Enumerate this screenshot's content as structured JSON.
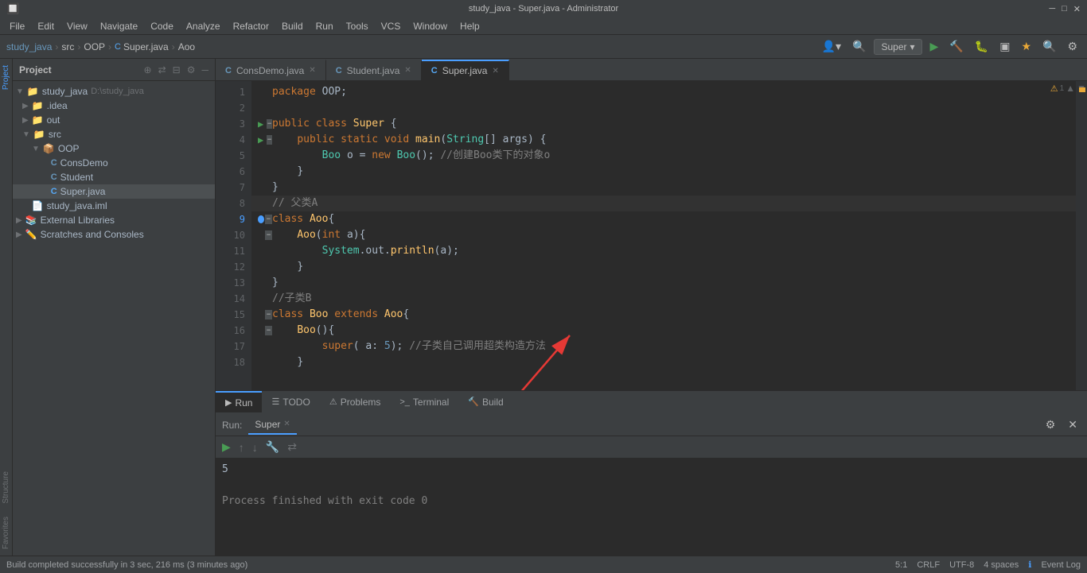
{
  "titleBar": {
    "title": "study_java - Super.java - Administrator",
    "minimize": "─",
    "maximize": "□",
    "close": "✕"
  },
  "menuBar": {
    "items": [
      "File",
      "Edit",
      "View",
      "Navigate",
      "Code",
      "Analyze",
      "Refactor",
      "Build",
      "Run",
      "Tools",
      "VCS",
      "Window",
      "Help"
    ]
  },
  "navBar": {
    "breadcrumb": [
      "study_java",
      "src",
      "OOP",
      "Super.java",
      "Aoo"
    ],
    "runConfig": "Super",
    "seps": [
      ">",
      ">",
      ">",
      ">"
    ]
  },
  "projectPanel": {
    "title": "Project",
    "tree": [
      {
        "label": "study_java",
        "path": "D:\\study_java",
        "indent": 0,
        "icon": "project",
        "arrow": "▼",
        "expanded": true
      },
      {
        "label": ".idea",
        "indent": 1,
        "icon": "folder",
        "arrow": "▶",
        "expanded": false
      },
      {
        "label": "out",
        "indent": 1,
        "icon": "folder-yellow",
        "arrow": "▶",
        "expanded": false
      },
      {
        "label": "src",
        "indent": 1,
        "icon": "folder",
        "arrow": "▼",
        "expanded": true
      },
      {
        "label": "OOP",
        "indent": 2,
        "icon": "folder-blue",
        "arrow": "▼",
        "expanded": true
      },
      {
        "label": "ConsDemo",
        "indent": 3,
        "icon": "java-class",
        "arrow": ""
      },
      {
        "label": "Student",
        "indent": 3,
        "icon": "java-class",
        "arrow": ""
      },
      {
        "label": "Super.java",
        "indent": 3,
        "icon": "java-class-active",
        "arrow": ""
      },
      {
        "label": "study_java.iml",
        "indent": 1,
        "icon": "iml",
        "arrow": ""
      },
      {
        "label": "External Libraries",
        "indent": 0,
        "icon": "library",
        "arrow": "▶",
        "expanded": false
      },
      {
        "label": "Scratches and Consoles",
        "indent": 0,
        "icon": "scratches",
        "arrow": "▶",
        "expanded": false
      }
    ]
  },
  "tabs": [
    {
      "label": "ConsDemo.java",
      "icon": "C",
      "iconColor": "#6897bb",
      "active": false,
      "modified": false
    },
    {
      "label": "Student.java",
      "icon": "C",
      "iconColor": "#6897bb",
      "active": false,
      "modified": false
    },
    {
      "label": "Super.java",
      "icon": "C",
      "iconColor": "#56a8f5",
      "active": true,
      "modified": false
    }
  ],
  "code": {
    "lines": [
      {
        "num": 1,
        "content": "package OOP;",
        "hasArrow": false,
        "hasFold": false,
        "hasRun": false,
        "highlighted": false
      },
      {
        "num": 2,
        "content": "",
        "hasArrow": false,
        "hasFold": false,
        "hasRun": false,
        "highlighted": false
      },
      {
        "num": 3,
        "content": "public class Super {",
        "hasArrow": false,
        "hasFold": true,
        "hasRun": true,
        "highlighted": false
      },
      {
        "num": 4,
        "content": "    public static void main(String[] args) {",
        "hasArrow": false,
        "hasFold": true,
        "hasRun": true,
        "highlighted": false
      },
      {
        "num": 5,
        "content": "        Boo o = new Boo(); //创建Boo类下的对象o",
        "hasArrow": false,
        "hasFold": false,
        "hasRun": false,
        "highlighted": false
      },
      {
        "num": 6,
        "content": "    }",
        "hasArrow": false,
        "hasFold": false,
        "hasRun": false,
        "highlighted": false
      },
      {
        "num": 7,
        "content": "}",
        "hasArrow": false,
        "hasFold": false,
        "hasRun": false,
        "highlighted": false
      },
      {
        "num": 8,
        "content": "// 父类A",
        "hasArrow": false,
        "hasFold": false,
        "hasRun": false,
        "highlighted": true
      },
      {
        "num": 9,
        "content": "class Aoo{",
        "hasArrow": false,
        "hasFold": true,
        "hasRun": true,
        "highlighted": false
      },
      {
        "num": 10,
        "content": "    Aoo(int a){",
        "hasArrow": false,
        "hasFold": true,
        "hasRun": false,
        "highlighted": false
      },
      {
        "num": 11,
        "content": "        System.out.println(a);",
        "hasArrow": false,
        "hasFold": false,
        "hasRun": false,
        "highlighted": false
      },
      {
        "num": 12,
        "content": "    }",
        "hasArrow": false,
        "hasFold": false,
        "hasRun": false,
        "highlighted": false
      },
      {
        "num": 13,
        "content": "}",
        "hasArrow": false,
        "hasFold": false,
        "hasRun": false,
        "highlighted": false
      },
      {
        "num": 14,
        "content": "//子类B",
        "hasArrow": false,
        "hasFold": false,
        "hasRun": false,
        "highlighted": false
      },
      {
        "num": 15,
        "content": "class Boo extends Aoo{",
        "hasArrow": false,
        "hasFold": true,
        "hasRun": false,
        "highlighted": false
      },
      {
        "num": 16,
        "content": "    Boo(){",
        "hasArrow": false,
        "hasFold": true,
        "hasRun": false,
        "highlighted": false
      },
      {
        "num": 17,
        "content": "        super( a: 5); //子类自己调用超类构造方法",
        "hasArrow": false,
        "hasFold": false,
        "hasRun": false,
        "highlighted": false
      },
      {
        "num": 18,
        "content": "    }",
        "hasArrow": false,
        "hasFold": false,
        "hasRun": false,
        "highlighted": false
      }
    ]
  },
  "runPanel": {
    "runLabel": "Run:",
    "tabLabel": "Super",
    "settingsIcon": "⚙",
    "closeIcon": "✕",
    "output": [
      {
        "text": "5",
        "type": "normal"
      },
      {
        "text": "",
        "type": "normal"
      },
      {
        "text": "Process finished with exit code 0",
        "type": "gray"
      }
    ]
  },
  "bottomTabs": [
    {
      "label": "Run",
      "icon": "▶",
      "active": true
    },
    {
      "label": "TODO",
      "icon": "☰",
      "active": false
    },
    {
      "label": "Problems",
      "icon": "⚠",
      "active": false
    },
    {
      "label": "Terminal",
      "icon": ">_",
      "active": false
    },
    {
      "label": "Build",
      "icon": "🔨",
      "active": false
    }
  ],
  "statusBar": {
    "buildStatus": "Build completed successfully in 3 sec, 216 ms (3 minutes ago)",
    "position": "5:1",
    "lineEnding": "CRLF",
    "encoding": "UTF-8",
    "indent": "4 spaces",
    "eventLog": "Event Log"
  },
  "sidebarLeft": {
    "tabs": [
      "Project",
      "Structure",
      "Favorites"
    ]
  }
}
